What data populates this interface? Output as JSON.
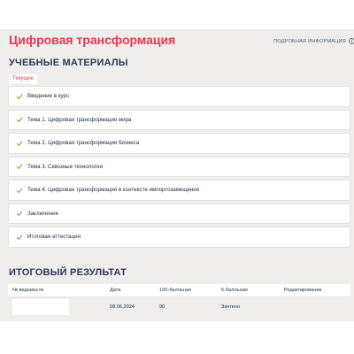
{
  "header": {
    "course_title": "Цифровая трансформация",
    "details_link": "ПОДРОБНАЯ ИНФОРМАЦИЯ"
  },
  "materials": {
    "title": "УЧЕБНЫЕ МАТЕРИАЛЫ",
    "tab_current": "Текущие",
    "items": [
      {
        "label": "Введение в курс",
        "status_icon": "check-icon"
      },
      {
        "label": "Тема 1. Цифровая трансформация мира",
        "status_icon": "check-icon"
      },
      {
        "label": "Тема 2. Цифровая трансформация бизнеса",
        "status_icon": "check-icon"
      },
      {
        "label": "Тема 3. Сквозные технологии",
        "status_icon": "check-icon"
      },
      {
        "label": "Тема 4. Цифровая трансформация в контексте импортозамещения",
        "status_icon": "check-icon"
      },
      {
        "label": "Заключение",
        "status_icon": "check-icon"
      },
      {
        "label": "Итоговая аттестация",
        "status_icon": "check-icon"
      }
    ]
  },
  "result": {
    "title": "ИТОГОВЫЙ РЕЗУЛЬТАТ",
    "columns": [
      "№ ведомости",
      "Дата",
      "100-балльная",
      "5-балльная",
      "Редактирование"
    ],
    "row": {
      "sheet_number": "",
      "date": "08.06.2024",
      "score_100": "90",
      "score_5": "Зачтено",
      "edit": ""
    }
  },
  "colors": {
    "accent": "#e53950",
    "check": "#7cb342",
    "heading": "#2c3a55",
    "background": "#efeeec"
  }
}
